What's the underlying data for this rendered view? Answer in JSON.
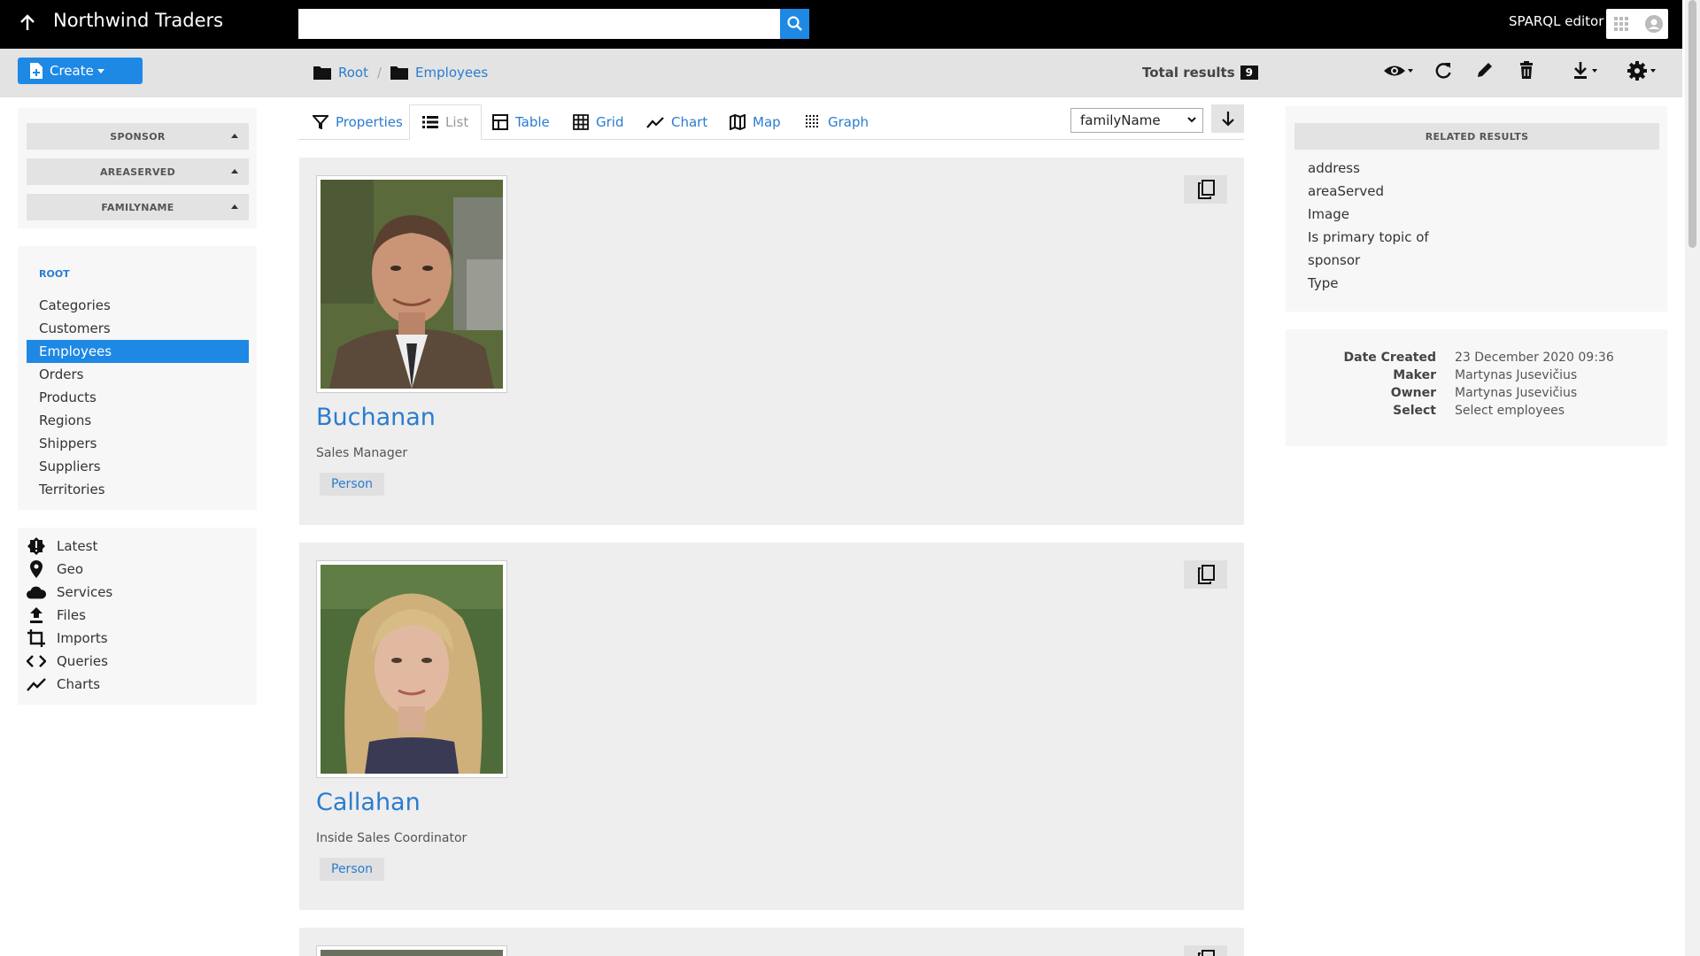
{
  "header": {
    "title": "Northwind Traders",
    "search_value": "",
    "sparql_label": "SPARQL editor",
    "search_icon": "search-icon",
    "up_icon": "arrow-up-icon",
    "apps_icon": "apps-grid-icon",
    "account_icon": "account-icon"
  },
  "toolbar": {
    "create_label": "Create",
    "breadcrumbs": [
      {
        "label": "Root",
        "icon": "folder-icon"
      },
      {
        "label": "Employees",
        "icon": "folder-icon"
      }
    ],
    "total_label": "Total results",
    "total_count": "9",
    "actions": [
      "eye-icon",
      "refresh-icon",
      "edit-icon",
      "delete-icon",
      "download-icon",
      "settings-icon"
    ]
  },
  "facets": [
    {
      "label": "SPONSOR"
    },
    {
      "label": "AREASERVED"
    },
    {
      "label": "FAMILYNAME"
    }
  ],
  "nav": {
    "root_label": "ROOT",
    "items": [
      "Categories",
      "Customers",
      "Employees",
      "Orders",
      "Products",
      "Regions",
      "Shippers",
      "Suppliers",
      "Territories"
    ],
    "active": "Employees"
  },
  "utilities": [
    {
      "label": "Latest",
      "icon": "alert-icon"
    },
    {
      "label": "Geo",
      "icon": "map-pin-icon"
    },
    {
      "label": "Services",
      "icon": "cloud-icon"
    },
    {
      "label": "Files",
      "icon": "upload-icon"
    },
    {
      "label": "Imports",
      "icon": "crop-icon"
    },
    {
      "label": "Queries",
      "icon": "code-icon"
    },
    {
      "label": "Charts",
      "icon": "chart-line-icon"
    }
  ],
  "modes": [
    {
      "label": "Properties",
      "icon": "funnel-icon"
    },
    {
      "label": "List",
      "icon": "list-icon"
    },
    {
      "label": "Table",
      "icon": "table-icon"
    },
    {
      "label": "Grid",
      "icon": "grid-icon"
    },
    {
      "label": "Chart",
      "icon": "chart-line-icon"
    },
    {
      "label": "Map",
      "icon": "map-icon"
    },
    {
      "label": "Graph",
      "icon": "graph-icon"
    }
  ],
  "active_mode": "List",
  "sort": {
    "selected": "familyName",
    "direction_icon": "arrow-down-icon"
  },
  "cards": [
    {
      "name": "Buchanan",
      "role": "Sales Manager",
      "type": "Person"
    },
    {
      "name": "Callahan",
      "role": "Inside Sales Coordinator",
      "type": "Person"
    }
  ],
  "related": {
    "heading": "RELATED RESULTS",
    "items": [
      "address",
      "areaServed",
      "Image",
      "Is primary topic of",
      "sponsor",
      "Type"
    ]
  },
  "meta": [
    {
      "label": "Date Created",
      "value": "23 December 2020 09:36",
      "link": false
    },
    {
      "label": "Maker",
      "value": "Martynas Jusevičius",
      "link": true
    },
    {
      "label": "Owner",
      "value": "Martynas Jusevičius",
      "link": true
    },
    {
      "label": "Select",
      "value": "Select employees",
      "link": true
    }
  ],
  "colors": {
    "accent": "#1e88e5",
    "link": "#2a7ccf",
    "topbar": "#000000",
    "toolbar": "#e3e3e3"
  }
}
